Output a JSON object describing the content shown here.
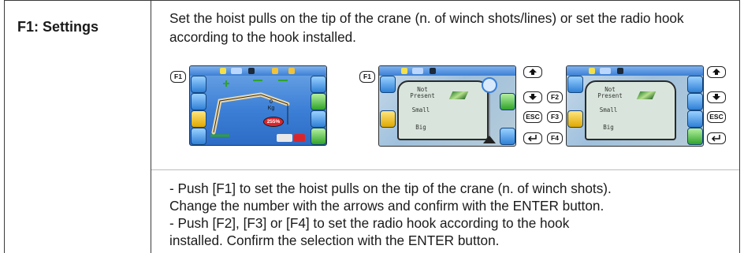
{
  "row": {
    "label": "F1: Settings",
    "intro": "Set the hoist pulls on the tip of the crane (n. of winch shots/lines) or set the radio hook according to the hook installed.",
    "steps": [
      "- Push [F1] to set the hoist pulls on the tip of the crane (n. of winch shots).",
      "Change the number with the arrows and confirm with the ENTER button.",
      "- Push [F2], [F3] or [F4] to set the radio hook according to the hook",
      "installed. Confirm the selection with the ENTER button."
    ]
  },
  "keys": {
    "f1": "F1",
    "f2": "F2",
    "f3": "F3",
    "f4": "F4",
    "esc": "ESC"
  },
  "screens": {
    "main": {
      "load_value": "0",
      "load_unit": "Kg",
      "percent_badge": "255%"
    },
    "hook_menu": {
      "options": [
        "Not Present",
        "Small",
        "Big"
      ]
    }
  },
  "colors": {
    "border": "#3a3a3a",
    "divider": "#bdbdbd",
    "screen_blue": "#3c7fd6",
    "badge_red": "#d9262c"
  }
}
